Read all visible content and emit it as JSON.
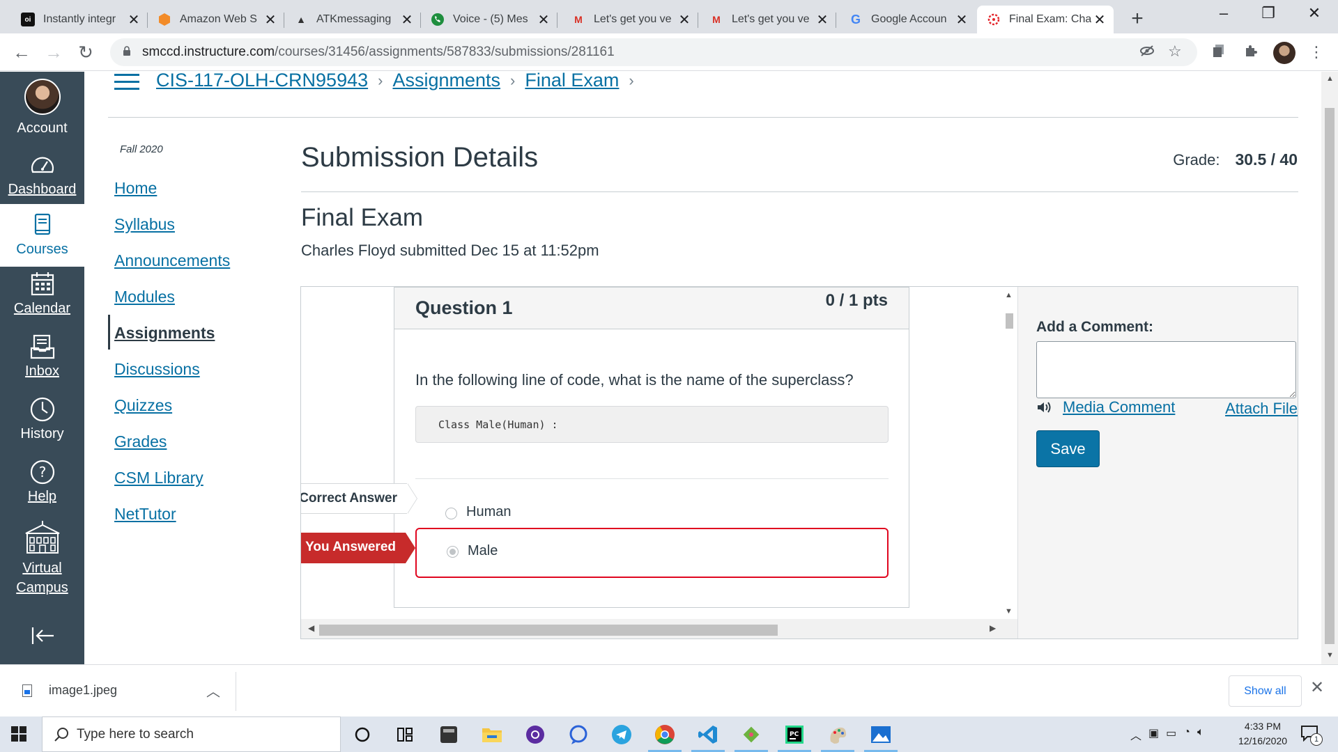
{
  "browser": {
    "tabs": [
      {
        "title": "Instantly integr",
        "icon": "otter-icon"
      },
      {
        "title": "Amazon Web S",
        "icon": "aws-icon"
      },
      {
        "title": "ATKmessaging",
        "icon": "atk-icon"
      },
      {
        "title": "Voice - (5) Mes",
        "icon": "voice-icon"
      },
      {
        "title": "Let's get you ve",
        "icon": "gmail-icon"
      },
      {
        "title": "Let's get you ve",
        "icon": "gmail-icon"
      },
      {
        "title": "Google Accoun",
        "icon": "google-icon"
      },
      {
        "title": "Final Exam: Cha",
        "icon": "canvas-icon"
      }
    ],
    "url_host": "smccd.instructure.com",
    "url_path": "/courses/31456/assignments/587833/submissions/281161"
  },
  "global_nav": {
    "account": "Account",
    "dashboard": "Dashboard",
    "courses": "Courses",
    "calendar": "Calendar",
    "inbox": "Inbox",
    "history": "History",
    "help": "Help",
    "virtual_campus": "Virtual Campus"
  },
  "breadcrumbs": {
    "course": "CIS-117-OLH-CRN95943",
    "assignments": "Assignments",
    "final_exam": "Final Exam"
  },
  "course_nav": {
    "term": "Fall 2020",
    "items": [
      "Home",
      "Syllabus",
      "Announcements",
      "Modules",
      "Assignments",
      "Discussions",
      "Quizzes",
      "Grades",
      "CSM Library",
      "NetTutor"
    ]
  },
  "submission": {
    "page_title": "Submission Details",
    "grade_label": "Grade:",
    "grade_value": "30.5 / 40",
    "assignment_name": "Final Exam",
    "submitted_text": "Charles Floyd submitted Dec 15 at 11:52pm"
  },
  "question": {
    "title": "Question 1",
    "points": "0 / 1 pts",
    "text": "In the following line of code, what is the name of the superclass?",
    "code": "Class Male(Human) :",
    "correct_flag": "Correct Answer",
    "wrong_flag": "You Answered",
    "answers": [
      "Human",
      "Male"
    ]
  },
  "comments": {
    "label": "Add a Comment:",
    "media_comment": "Media Comment",
    "attach_file": "Attach File",
    "save": "Save"
  },
  "download_bar": {
    "file_name": "image1.jpeg",
    "show_all": "Show all"
  },
  "taskbar": {
    "search_placeholder": "Type here to search",
    "time": "4:33 PM",
    "date": "12/16/2020",
    "notification_count": "1"
  }
}
